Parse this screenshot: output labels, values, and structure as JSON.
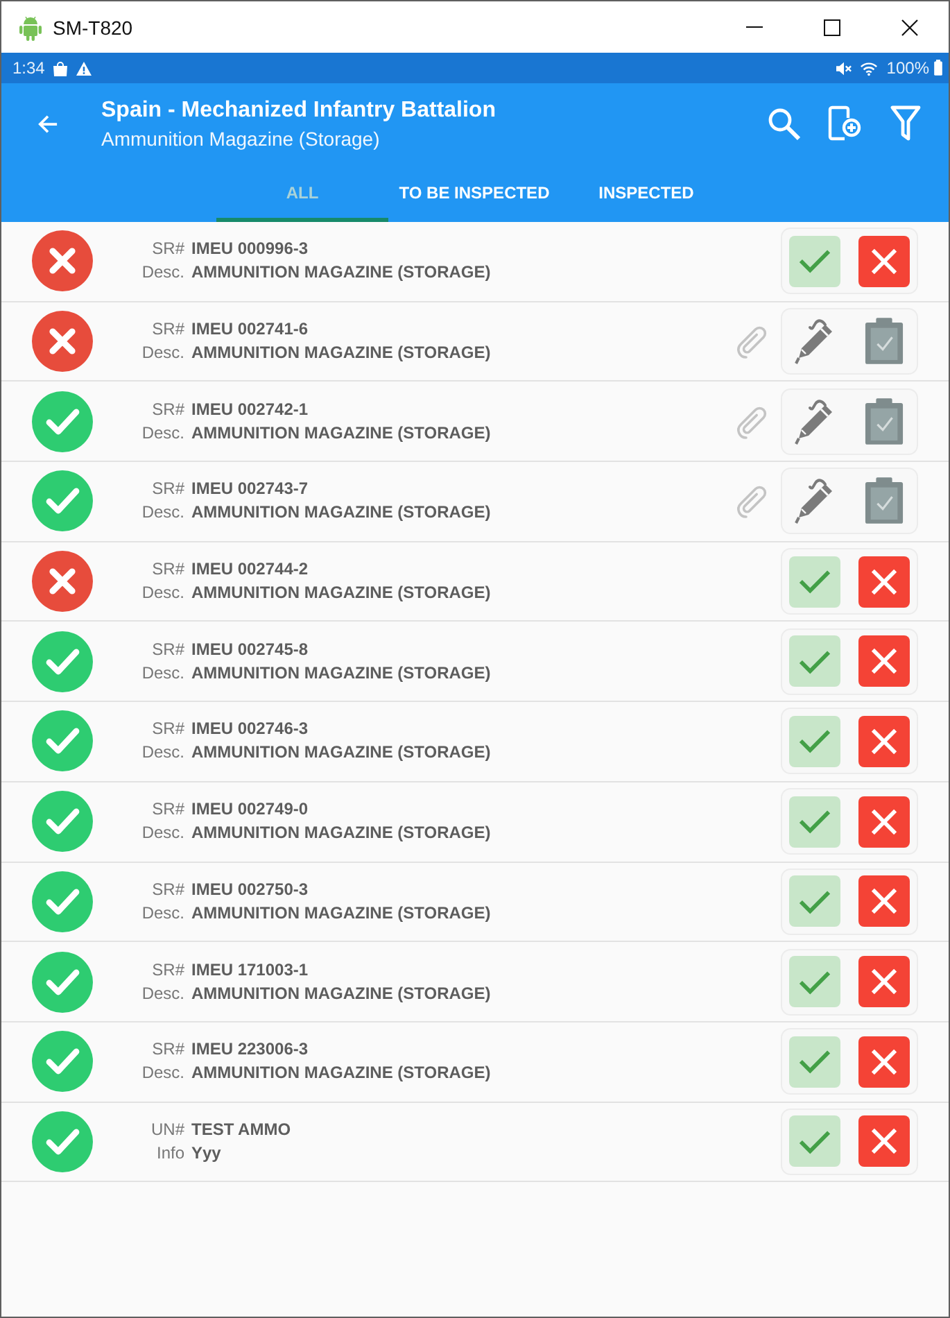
{
  "window": {
    "title": "SM-T820"
  },
  "status_bar": {
    "time": "1:34",
    "battery": "100%"
  },
  "app_bar": {
    "title": "Spain - Mechanized Infantry Battalion",
    "subtitle": "Ammunition Magazine (Storage)"
  },
  "tabs": [
    {
      "label": "ALL",
      "selected": true
    },
    {
      "label": "TO BE INSPECTED",
      "selected": false
    },
    {
      "label": "INSPECTED",
      "selected": false
    }
  ],
  "items": [
    {
      "passed": false,
      "kind": "review",
      "fields": [
        {
          "label": "SR#",
          "value": "IMEU 000996-3"
        },
        {
          "label": "Desc.",
          "value": "AMMUNITION MAGAZINE (STORAGE)"
        }
      ]
    },
    {
      "passed": false,
      "kind": "inspected",
      "fields": [
        {
          "label": "SR#",
          "value": "IMEU 002741-6"
        },
        {
          "label": "Desc.",
          "value": "AMMUNITION MAGAZINE (STORAGE)"
        }
      ]
    },
    {
      "passed": true,
      "kind": "inspected",
      "fields": [
        {
          "label": "SR#",
          "value": "IMEU 002742-1"
        },
        {
          "label": "Desc.",
          "value": "AMMUNITION MAGAZINE (STORAGE)"
        }
      ]
    },
    {
      "passed": true,
      "kind": "inspected",
      "fields": [
        {
          "label": "SR#",
          "value": "IMEU 002743-7"
        },
        {
          "label": "Desc.",
          "value": "AMMUNITION MAGAZINE (STORAGE)"
        }
      ]
    },
    {
      "passed": false,
      "kind": "review",
      "fields": [
        {
          "label": "SR#",
          "value": "IMEU 002744-2"
        },
        {
          "label": "Desc.",
          "value": "AMMUNITION MAGAZINE (STORAGE)"
        }
      ]
    },
    {
      "passed": true,
      "kind": "review",
      "fields": [
        {
          "label": "SR#",
          "value": "IMEU 002745-8"
        },
        {
          "label": "Desc.",
          "value": "AMMUNITION MAGAZINE (STORAGE)"
        }
      ]
    },
    {
      "passed": true,
      "kind": "review",
      "fields": [
        {
          "label": "SR#",
          "value": "IMEU 002746-3"
        },
        {
          "label": "Desc.",
          "value": "AMMUNITION MAGAZINE (STORAGE)"
        }
      ]
    },
    {
      "passed": true,
      "kind": "review",
      "fields": [
        {
          "label": "SR#",
          "value": "IMEU 002749-0"
        },
        {
          "label": "Desc.",
          "value": "AMMUNITION MAGAZINE (STORAGE)"
        }
      ]
    },
    {
      "passed": true,
      "kind": "review",
      "fields": [
        {
          "label": "SR#",
          "value": "IMEU 002750-3"
        },
        {
          "label": "Desc.",
          "value": "AMMUNITION MAGAZINE (STORAGE)"
        }
      ]
    },
    {
      "passed": true,
      "kind": "review",
      "fields": [
        {
          "label": "SR#",
          "value": "IMEU 171003-1"
        },
        {
          "label": "Desc.",
          "value": "AMMUNITION MAGAZINE (STORAGE)"
        }
      ]
    },
    {
      "passed": true,
      "kind": "review",
      "fields": [
        {
          "label": "SR#",
          "value": "IMEU 223006-3"
        },
        {
          "label": "Desc.",
          "value": "AMMUNITION MAGAZINE (STORAGE)"
        }
      ]
    },
    {
      "passed": true,
      "kind": "review",
      "fields": [
        {
          "label": "UN#",
          "value": "TEST AMMO"
        },
        {
          "label": "Info",
          "value": "Yyy"
        }
      ]
    }
  ]
}
